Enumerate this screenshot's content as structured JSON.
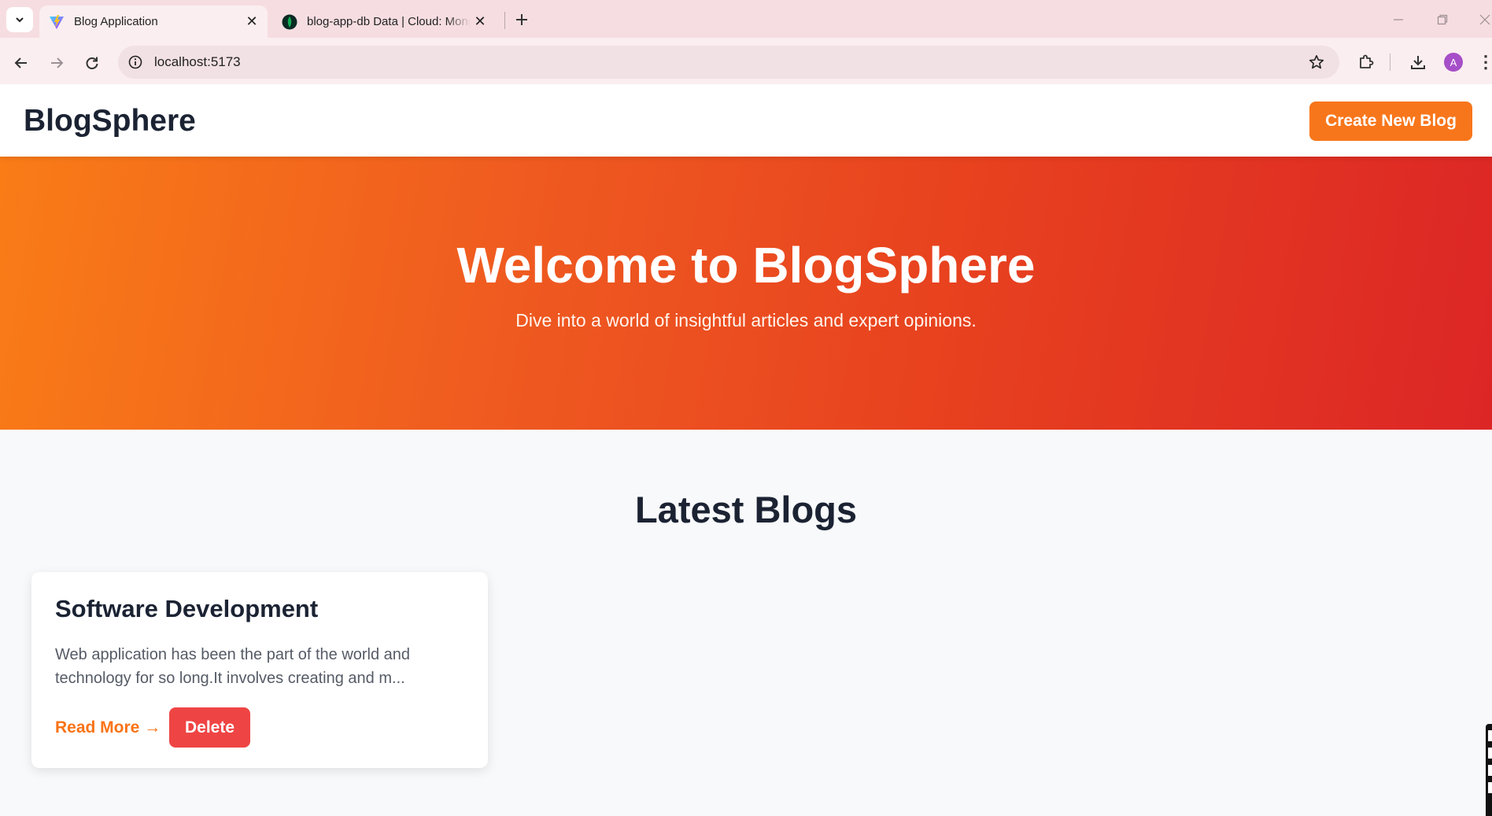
{
  "browser": {
    "tabs": [
      {
        "title": "Blog Application",
        "active": true,
        "favicon": "vite-logo-icon"
      },
      {
        "title": "blog-app-db Data | Cloud: MongoDB Cloud",
        "active": false,
        "favicon": "mongodb-leaf-icon"
      }
    ],
    "url": "localhost:5173",
    "profile_initial": "A"
  },
  "header": {
    "brand": "BlogSphere",
    "cta_label": "Create New Blog"
  },
  "hero": {
    "title": "Welcome to BlogSphere",
    "subtitle": "Dive into a world of insightful articles and expert opinions."
  },
  "blogs_section": {
    "title": "Latest Blogs",
    "posts": [
      {
        "title": "Software Development",
        "excerpt": "Web application has been the part of the world and technology for so long.It involves creating and m...",
        "read_more_label": "Read More →",
        "delete_label": "Delete"
      }
    ]
  },
  "colors": {
    "accent": "#f97316",
    "hero_gradient_start": "#f97c17",
    "hero_gradient_end": "#dc2626",
    "delete": "#ef4444",
    "text_dark": "#1b2333"
  }
}
